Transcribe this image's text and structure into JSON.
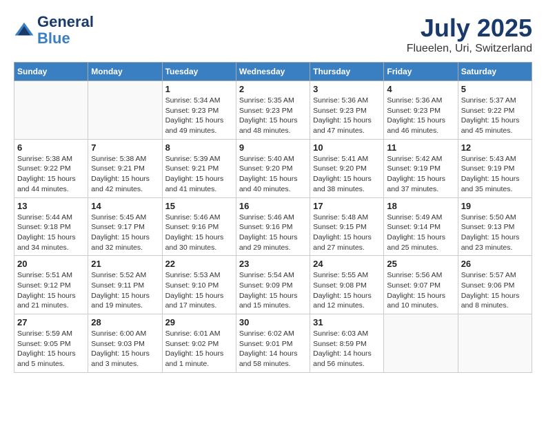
{
  "header": {
    "logo_line1": "General",
    "logo_line2": "Blue",
    "month": "July 2025",
    "location": "Flueelen, Uri, Switzerland"
  },
  "weekdays": [
    "Sunday",
    "Monday",
    "Tuesday",
    "Wednesday",
    "Thursday",
    "Friday",
    "Saturday"
  ],
  "weeks": [
    [
      {
        "day": "",
        "info": ""
      },
      {
        "day": "",
        "info": ""
      },
      {
        "day": "1",
        "info": "Sunrise: 5:34 AM\nSunset: 9:23 PM\nDaylight: 15 hours\nand 49 minutes."
      },
      {
        "day": "2",
        "info": "Sunrise: 5:35 AM\nSunset: 9:23 PM\nDaylight: 15 hours\nand 48 minutes."
      },
      {
        "day": "3",
        "info": "Sunrise: 5:36 AM\nSunset: 9:23 PM\nDaylight: 15 hours\nand 47 minutes."
      },
      {
        "day": "4",
        "info": "Sunrise: 5:36 AM\nSunset: 9:23 PM\nDaylight: 15 hours\nand 46 minutes."
      },
      {
        "day": "5",
        "info": "Sunrise: 5:37 AM\nSunset: 9:22 PM\nDaylight: 15 hours\nand 45 minutes."
      }
    ],
    [
      {
        "day": "6",
        "info": "Sunrise: 5:38 AM\nSunset: 9:22 PM\nDaylight: 15 hours\nand 44 minutes."
      },
      {
        "day": "7",
        "info": "Sunrise: 5:38 AM\nSunset: 9:21 PM\nDaylight: 15 hours\nand 42 minutes."
      },
      {
        "day": "8",
        "info": "Sunrise: 5:39 AM\nSunset: 9:21 PM\nDaylight: 15 hours\nand 41 minutes."
      },
      {
        "day": "9",
        "info": "Sunrise: 5:40 AM\nSunset: 9:20 PM\nDaylight: 15 hours\nand 40 minutes."
      },
      {
        "day": "10",
        "info": "Sunrise: 5:41 AM\nSunset: 9:20 PM\nDaylight: 15 hours\nand 38 minutes."
      },
      {
        "day": "11",
        "info": "Sunrise: 5:42 AM\nSunset: 9:19 PM\nDaylight: 15 hours\nand 37 minutes."
      },
      {
        "day": "12",
        "info": "Sunrise: 5:43 AM\nSunset: 9:19 PM\nDaylight: 15 hours\nand 35 minutes."
      }
    ],
    [
      {
        "day": "13",
        "info": "Sunrise: 5:44 AM\nSunset: 9:18 PM\nDaylight: 15 hours\nand 34 minutes."
      },
      {
        "day": "14",
        "info": "Sunrise: 5:45 AM\nSunset: 9:17 PM\nDaylight: 15 hours\nand 32 minutes."
      },
      {
        "day": "15",
        "info": "Sunrise: 5:46 AM\nSunset: 9:16 PM\nDaylight: 15 hours\nand 30 minutes."
      },
      {
        "day": "16",
        "info": "Sunrise: 5:46 AM\nSunset: 9:16 PM\nDaylight: 15 hours\nand 29 minutes."
      },
      {
        "day": "17",
        "info": "Sunrise: 5:48 AM\nSunset: 9:15 PM\nDaylight: 15 hours\nand 27 minutes."
      },
      {
        "day": "18",
        "info": "Sunrise: 5:49 AM\nSunset: 9:14 PM\nDaylight: 15 hours\nand 25 minutes."
      },
      {
        "day": "19",
        "info": "Sunrise: 5:50 AM\nSunset: 9:13 PM\nDaylight: 15 hours\nand 23 minutes."
      }
    ],
    [
      {
        "day": "20",
        "info": "Sunrise: 5:51 AM\nSunset: 9:12 PM\nDaylight: 15 hours\nand 21 minutes."
      },
      {
        "day": "21",
        "info": "Sunrise: 5:52 AM\nSunset: 9:11 PM\nDaylight: 15 hours\nand 19 minutes."
      },
      {
        "day": "22",
        "info": "Sunrise: 5:53 AM\nSunset: 9:10 PM\nDaylight: 15 hours\nand 17 minutes."
      },
      {
        "day": "23",
        "info": "Sunrise: 5:54 AM\nSunset: 9:09 PM\nDaylight: 15 hours\nand 15 minutes."
      },
      {
        "day": "24",
        "info": "Sunrise: 5:55 AM\nSunset: 9:08 PM\nDaylight: 15 hours\nand 12 minutes."
      },
      {
        "day": "25",
        "info": "Sunrise: 5:56 AM\nSunset: 9:07 PM\nDaylight: 15 hours\nand 10 minutes."
      },
      {
        "day": "26",
        "info": "Sunrise: 5:57 AM\nSunset: 9:06 PM\nDaylight: 15 hours\nand 8 minutes."
      }
    ],
    [
      {
        "day": "27",
        "info": "Sunrise: 5:59 AM\nSunset: 9:05 PM\nDaylight: 15 hours\nand 5 minutes."
      },
      {
        "day": "28",
        "info": "Sunrise: 6:00 AM\nSunset: 9:03 PM\nDaylight: 15 hours\nand 3 minutes."
      },
      {
        "day": "29",
        "info": "Sunrise: 6:01 AM\nSunset: 9:02 PM\nDaylight: 15 hours\nand 1 minute."
      },
      {
        "day": "30",
        "info": "Sunrise: 6:02 AM\nSunset: 9:01 PM\nDaylight: 14 hours\nand 58 minutes."
      },
      {
        "day": "31",
        "info": "Sunrise: 6:03 AM\nSunset: 8:59 PM\nDaylight: 14 hours\nand 56 minutes."
      },
      {
        "day": "",
        "info": ""
      },
      {
        "day": "",
        "info": ""
      }
    ]
  ]
}
